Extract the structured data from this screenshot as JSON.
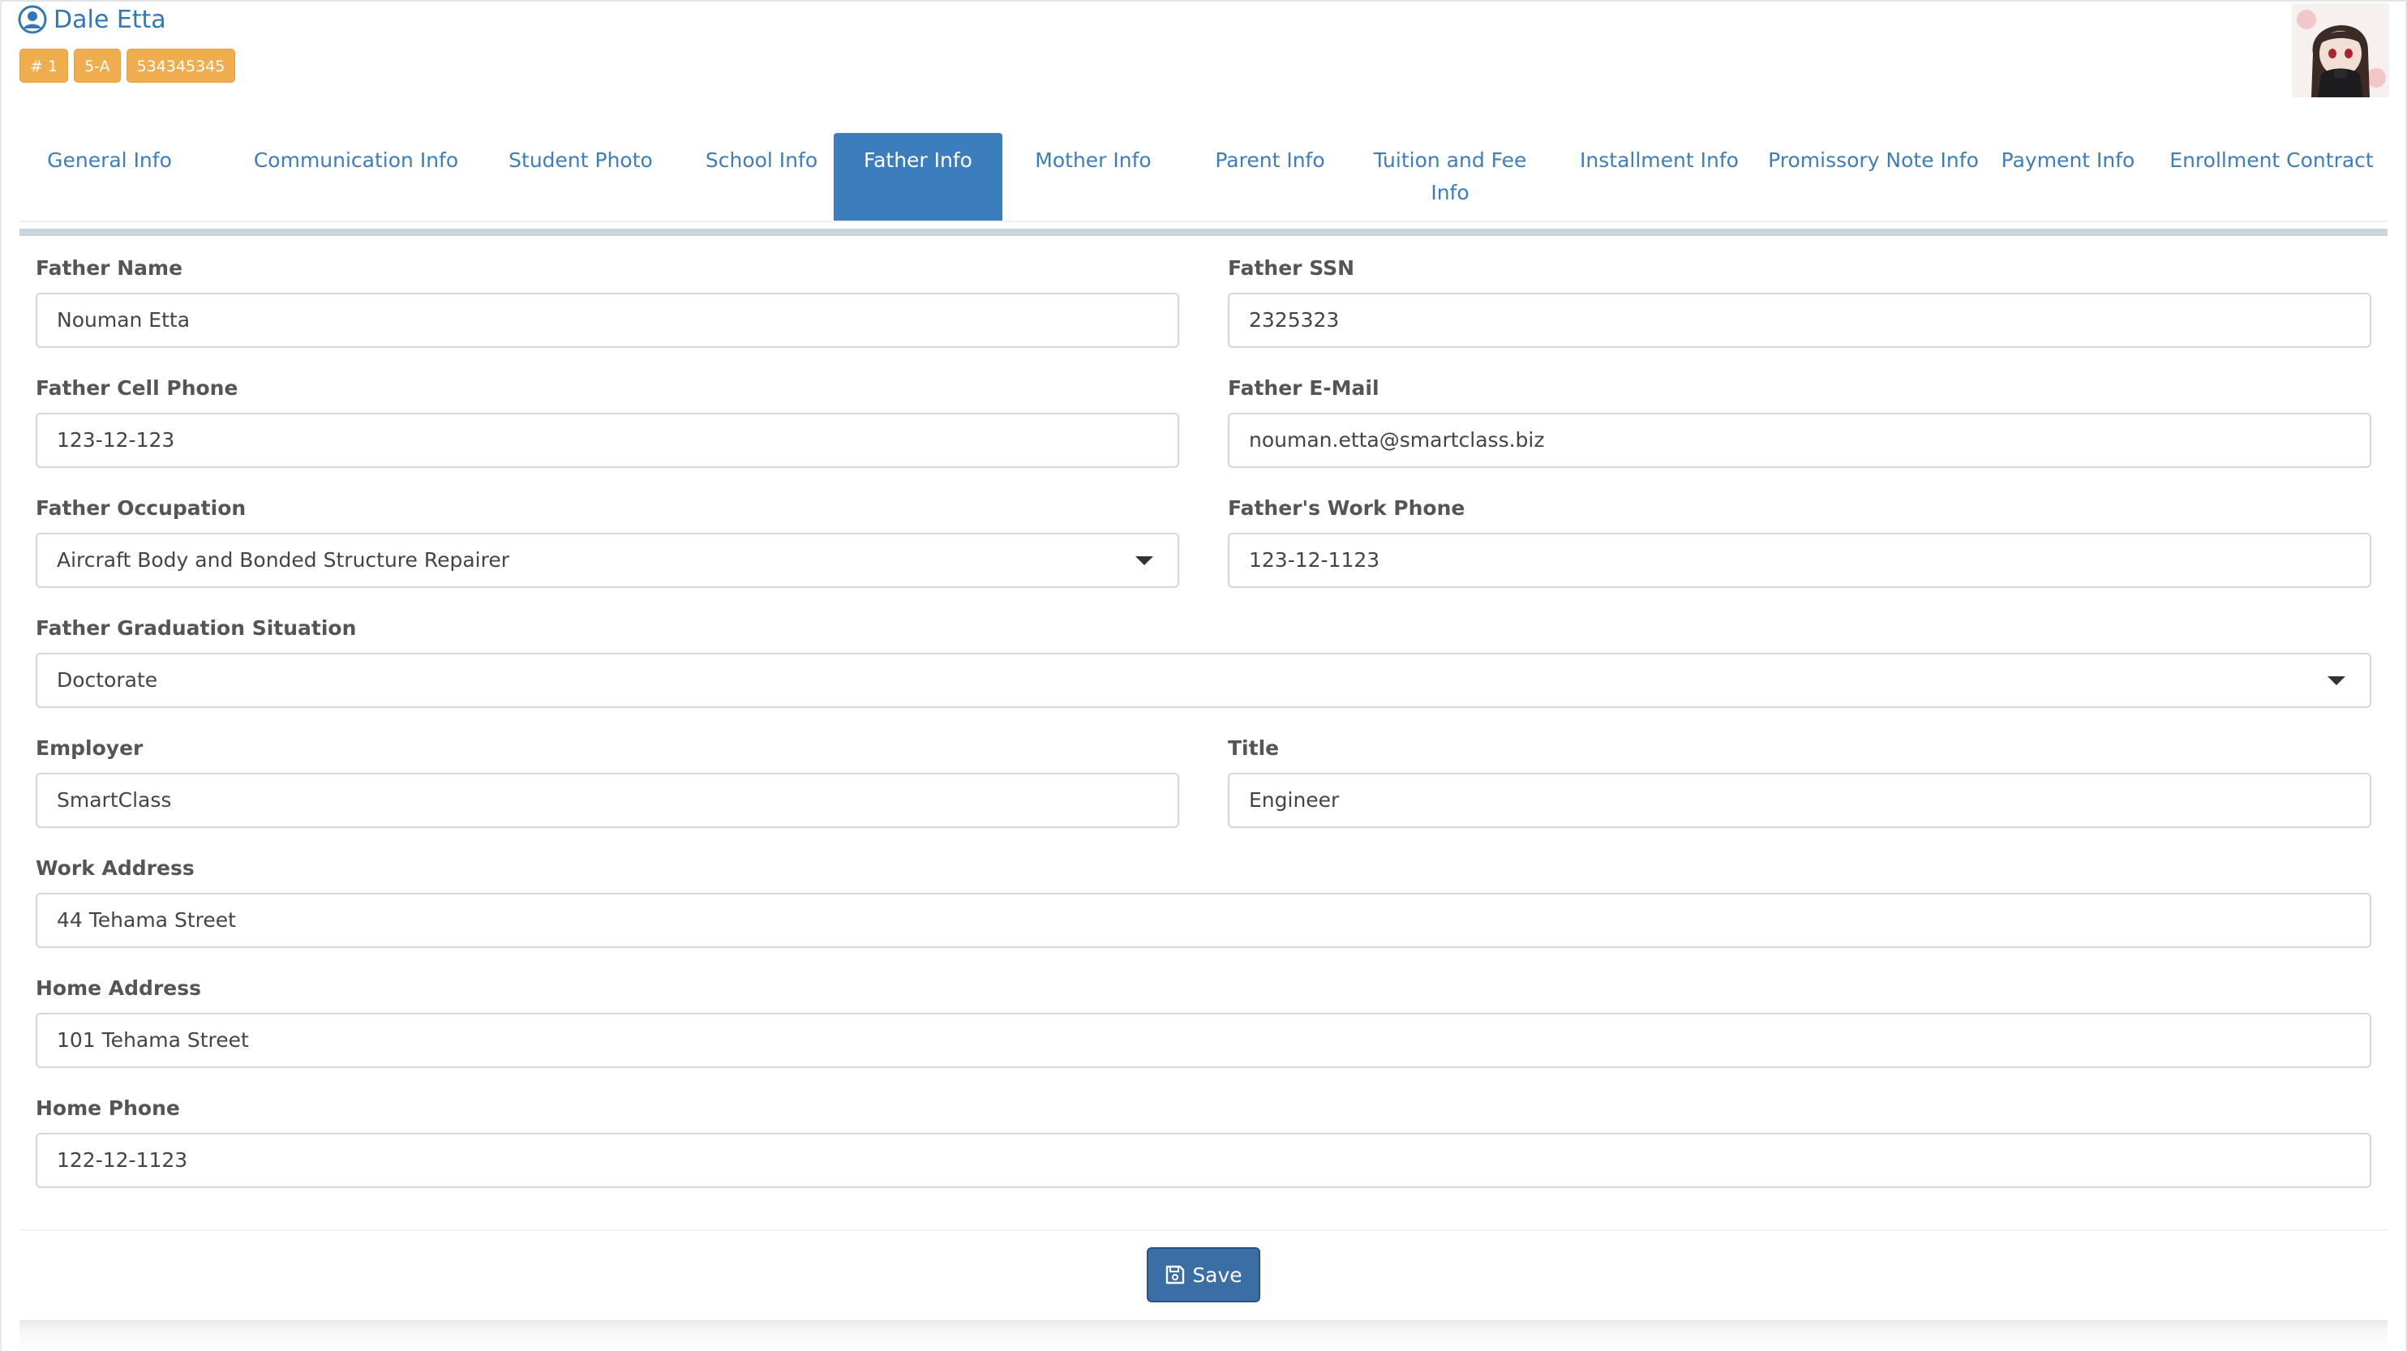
{
  "student": {
    "name": "Dale Etta",
    "badges": [
      "# 1",
      "5-A",
      "534345345"
    ]
  },
  "tabs": [
    {
      "label": "General Info",
      "active": false
    },
    {
      "label": "Communication Info",
      "active": false
    },
    {
      "label": "Student Photo",
      "active": false
    },
    {
      "label": "School Info",
      "active": false
    },
    {
      "label": "Father Info",
      "active": true
    },
    {
      "label": "Mother Info",
      "active": false
    },
    {
      "label": "Parent Info",
      "active": false
    },
    {
      "label": "Tuition and Fee Info",
      "active": false
    },
    {
      "label": "Installment Info",
      "active": false
    },
    {
      "label": "Promissory Note Info",
      "active": false
    },
    {
      "label": "Payment Info",
      "active": false
    },
    {
      "label": "Enrollment Contract",
      "active": false
    }
  ],
  "form": {
    "father_name": {
      "label": "Father Name",
      "value": "Nouman Etta"
    },
    "father_ssn": {
      "label": "Father SSN",
      "value": "2325323"
    },
    "father_cell_phone": {
      "label": "Father Cell Phone",
      "value": "123-12-123"
    },
    "father_email": {
      "label": "Father E-Mail",
      "value": "nouman.etta@smartclass.biz"
    },
    "father_occupation": {
      "label": "Father Occupation",
      "value": "Aircraft Body and Bonded Structure Repairer"
    },
    "father_work_phone": {
      "label": "Father's Work Phone",
      "value": "123-12-1123"
    },
    "father_graduation": {
      "label": "Father Graduation Situation",
      "value": "Doctorate"
    },
    "employer": {
      "label": "Employer",
      "value": "SmartClass"
    },
    "title": {
      "label": "Title",
      "value": "Engineer"
    },
    "work_address": {
      "label": "Work Address",
      "value": "44 Tehama Street"
    },
    "home_address": {
      "label": "Home Address",
      "value": "101 Tehama Street"
    },
    "home_phone": {
      "label": "Home Phone",
      "value": "122-12-1123"
    }
  },
  "footer": {
    "save_label": "Save"
  },
  "colors": {
    "accent": "#3c7dbd",
    "badge": "#f0ad4e",
    "save_button": "#3c6ea6"
  },
  "icons": {
    "user": "user-circle-icon",
    "save": "floppy-disk-icon",
    "select": "caret-down-icon"
  }
}
